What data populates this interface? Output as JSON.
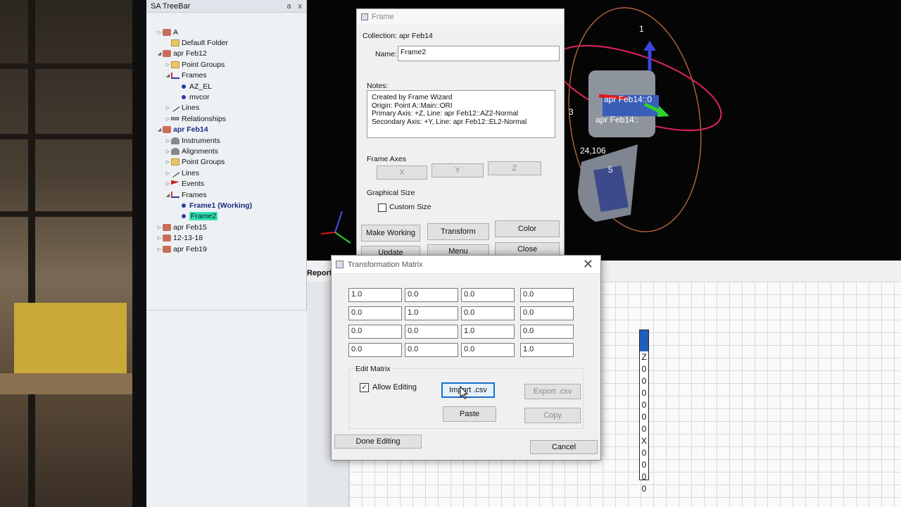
{
  "treebar": {
    "title": "SA TreeBar",
    "controls": [
      "a",
      "x"
    ],
    "items": [
      {
        "label": "A",
        "indent": 0,
        "icon": "collection",
        "exp": "▷"
      },
      {
        "label": "Default Folder",
        "indent": 1,
        "icon": "folder",
        "exp": ""
      },
      {
        "label": "apr Feb12",
        "indent": 0,
        "icon": "collection",
        "exp": "◢"
      },
      {
        "label": "Point Groups",
        "indent": 1,
        "icon": "folder",
        "exp": "▷"
      },
      {
        "label": "Frames",
        "indent": 1,
        "icon": "frame",
        "exp": "◢"
      },
      {
        "label": "AZ_EL",
        "indent": 2,
        "icon": "point",
        "exp": ""
      },
      {
        "label": "mvcor",
        "indent": 2,
        "icon": "point",
        "exp": ""
      },
      {
        "label": "Lines",
        "indent": 1,
        "icon": "line",
        "exp": "▷"
      },
      {
        "label": "Relationships",
        "indent": 1,
        "icon": "rel",
        "exp": "▷"
      },
      {
        "label": "apr Feb14",
        "indent": 0,
        "icon": "collection",
        "exp": "◢",
        "bold": true
      },
      {
        "label": "Instruments",
        "indent": 1,
        "icon": "inst",
        "exp": "▷"
      },
      {
        "label": "Alignments",
        "indent": 1,
        "icon": "inst",
        "exp": "▷"
      },
      {
        "label": "Point Groups",
        "indent": 1,
        "icon": "folder",
        "exp": "▷"
      },
      {
        "label": "Lines",
        "indent": 1,
        "icon": "line",
        "exp": "▷"
      },
      {
        "label": "Events",
        "indent": 1,
        "icon": "event",
        "exp": "▷"
      },
      {
        "label": "Frames",
        "indent": 1,
        "icon": "frame",
        "exp": "◢"
      },
      {
        "label": "Frame1 (Working)",
        "indent": 2,
        "icon": "point",
        "exp": "",
        "bold": true
      },
      {
        "label": "Frame2",
        "indent": 2,
        "icon": "point",
        "exp": "",
        "selected": true
      },
      {
        "label": "apr Feb15",
        "indent": 0,
        "icon": "collection",
        "exp": "▷"
      },
      {
        "label": "12-13-18",
        "indent": 0,
        "icon": "collection",
        "exp": "▷"
      },
      {
        "label": "apr Feb19",
        "indent": 0,
        "icon": "collection",
        "exp": "▷"
      }
    ]
  },
  "view3d": {
    "labels": [
      {
        "text": "1",
        "color": "#ffffff"
      },
      {
        "text": "3",
        "color": "#ffffff"
      },
      {
        "text": "apr Feb14::0",
        "color": "#ffffff"
      },
      {
        "text": "apr Feb14::",
        "color": "#ffffff"
      },
      {
        "text": "24,106",
        "color": "#ffffff"
      },
      {
        "text": "5",
        "color": "#ffffff"
      }
    ]
  },
  "frame_dialog": {
    "title": "Frame",
    "collection_label": "Collection: apr Feb14",
    "name_label": "Name:",
    "name_value": "Frame2",
    "notes_label": "Notes:",
    "notes_lines": [
      "Created by Frame Wizard",
      "Origin:  Point  A::Main::ORI",
      "Primary Axis: +Z, Line: apr Feb12::AZ2-Normal",
      "Secondary Axis: +Y, Line: apr Feb12::EL2-Normal"
    ],
    "frame_axes_label": "Frame Axes",
    "axis_x": "X",
    "axis_y": "Y",
    "axis_z": "Z",
    "graphical_size_label": "Graphical Size",
    "custom_size_label": "Custom Size",
    "make_working": "Make Working",
    "transform": "Transform",
    "color": "Color",
    "update": "Update",
    "menu": "Menu",
    "close": "Close"
  },
  "tm_dialog": {
    "title": "Transformation Matrix",
    "matrix": [
      [
        "1.0",
        "0.0",
        "0.0",
        "0.0"
      ],
      [
        "0.0",
        "1.0",
        "0.0",
        "0.0"
      ],
      [
        "0.0",
        "0.0",
        "1.0",
        "0.0"
      ],
      [
        "0.0",
        "0.0",
        "0.0",
        "1.0"
      ]
    ],
    "edit_matrix_label": "Edit Matrix",
    "allow_editing_label": "Allow Editing",
    "allow_editing_checked": true,
    "import_csv": "Import .csv",
    "export_csv": "Export .csv",
    "paste": "Paste",
    "copy": "Copy",
    "done_editing": "Done Editing",
    "cancel": "Cancel"
  },
  "report": {
    "title": "Report",
    "column_header": "Z",
    "column_values": [
      "0",
      "0",
      "0",
      "0",
      "0",
      "0",
      "X",
      "0",
      "0",
      "0",
      "0"
    ]
  },
  "colors": {
    "selection": "#2fe3b6",
    "collection_bold": "#1a2a80",
    "ellipse_red": "#e0245e",
    "ellipse_brown": "#b0603a"
  }
}
